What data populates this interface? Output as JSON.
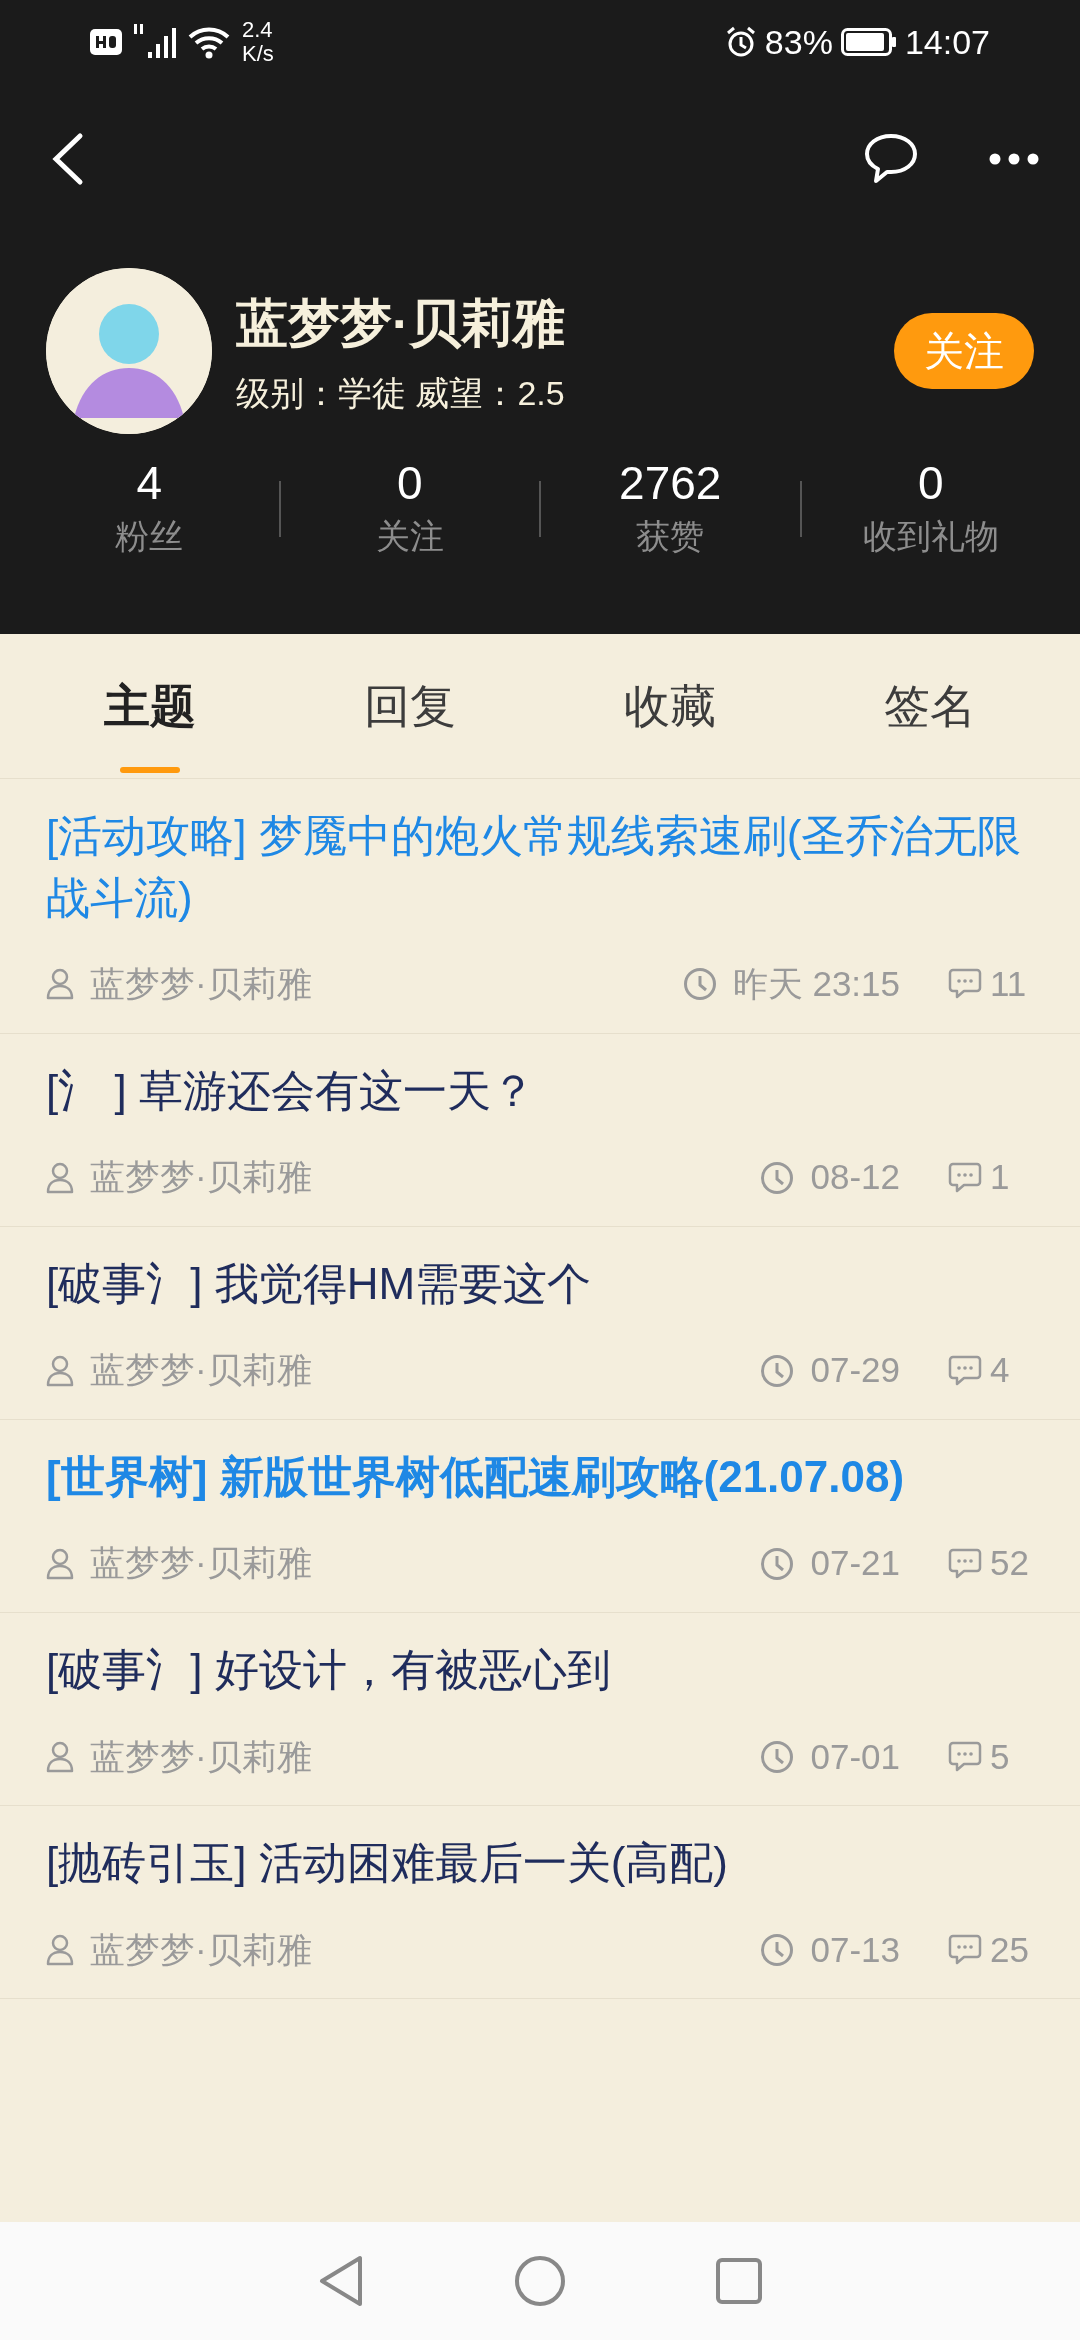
{
  "status_bar": {
    "net_speed_value": "2.4",
    "net_speed_unit": "K/s",
    "battery": "83%",
    "time": "14:07"
  },
  "profile": {
    "name": "蓝梦梦·贝莉雅",
    "info": "级别：学徒 威望：2.5",
    "follow_button": "关注"
  },
  "stats": [
    {
      "value": "4",
      "label": "粉丝"
    },
    {
      "value": "0",
      "label": "关注"
    },
    {
      "value": "2762",
      "label": "获赞"
    },
    {
      "value": "0",
      "label": "收到礼物"
    }
  ],
  "tabs": [
    {
      "label": "主题",
      "selected": true
    },
    {
      "label": "回复",
      "selected": false
    },
    {
      "label": "收藏",
      "selected": false
    },
    {
      "label": "签名",
      "selected": false
    }
  ],
  "posts": [
    {
      "title": "[活动攻略] 梦魇中的炮火常规线索速刷(圣乔治无限战斗流)",
      "color": "#1e88e5",
      "bold": false,
      "author": "蓝梦梦·贝莉雅",
      "time": "昨天  23:15",
      "replies": "11"
    },
    {
      "title": "[氵 ] 草游还会有这一天？",
      "color": "#1f2c5c",
      "bold": false,
      "author": "蓝梦梦·贝莉雅",
      "time": "08-12",
      "replies": "1"
    },
    {
      "title": "[破事氵] 我觉得HM需要这个",
      "color": "#1f2c5c",
      "bold": false,
      "author": "蓝梦梦·贝莉雅",
      "time": "07-29",
      "replies": "4"
    },
    {
      "title": "[世界树] 新版世界树低配速刷攻略(21.07.08)",
      "color": "#1e88e5",
      "bold": true,
      "author": "蓝梦梦·贝莉雅",
      "time": "07-21",
      "replies": "52"
    },
    {
      "title": "[破事氵] 好设计，有被恶心到",
      "color": "#1f2c5c",
      "bold": false,
      "author": "蓝梦梦·贝莉雅",
      "time": "07-01",
      "replies": "5"
    },
    {
      "title": "[抛砖引玉] 活动困难最后一关(高配)",
      "color": "#1f2c5c",
      "bold": false,
      "author": "蓝梦梦·贝莉雅",
      "time": "07-13",
      "replies": "25"
    }
  ]
}
